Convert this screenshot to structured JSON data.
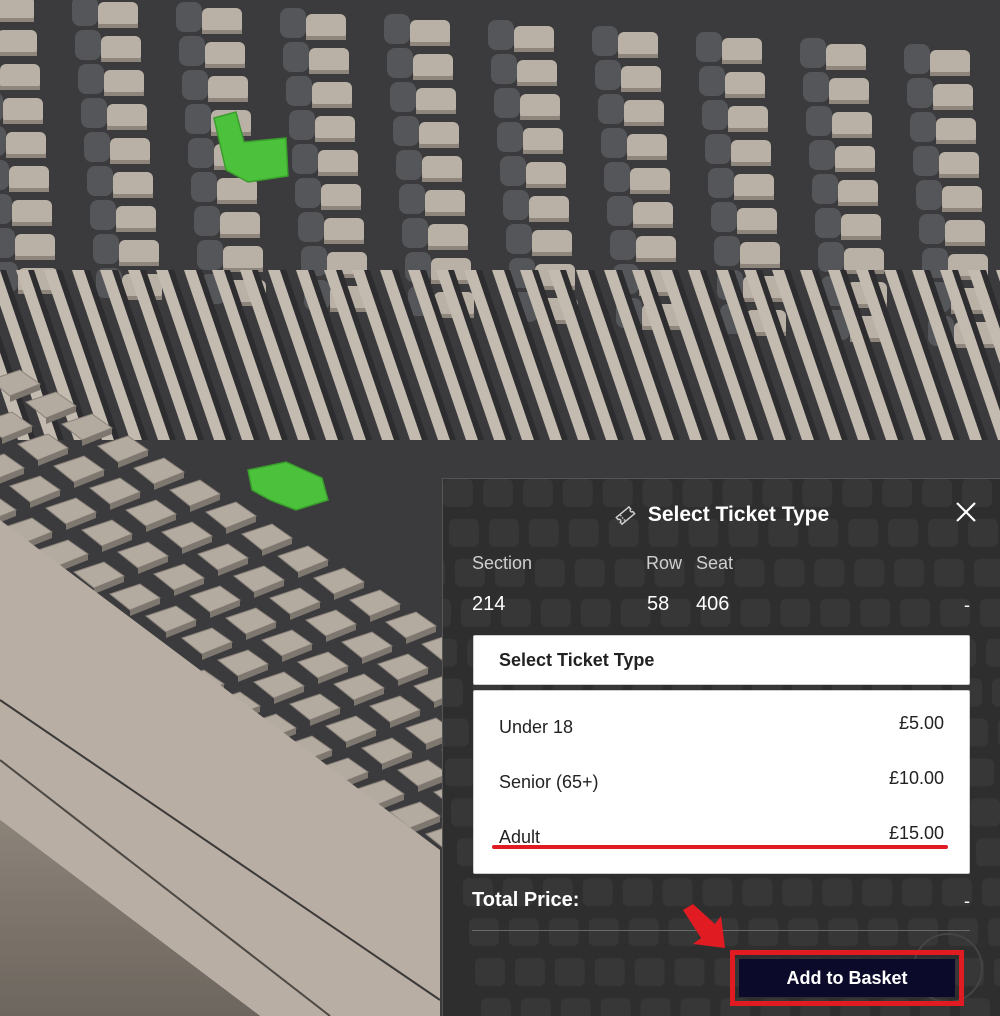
{
  "modal": {
    "title": "Select Ticket Type",
    "icon": "ticket-icon",
    "close_icon": "close-icon",
    "columns": {
      "section_label": "Section",
      "row_label": "Row",
      "seat_label": "Seat",
      "section_value": "214",
      "row_value": "58",
      "seat_value": "406",
      "price_value": "-"
    },
    "dropdown": {
      "selected_label": "Select Ticket Type",
      "options": [
        {
          "label": "Under 18",
          "price": "£5.00"
        },
        {
          "label": "Senior (65+)",
          "price": "£10.00"
        },
        {
          "label": "Adult",
          "price": "£15.00"
        }
      ]
    },
    "total": {
      "label": "Total Price:",
      "value": "-"
    },
    "add_button": "Add to Basket"
  },
  "colors": {
    "highlight": "#e11b22",
    "button_bg": "#0b0a2a",
    "selected_seat": "#4cc13b",
    "panel_bg": "#2e2e2e"
  },
  "seat_view": {
    "selected_seats": 2
  }
}
